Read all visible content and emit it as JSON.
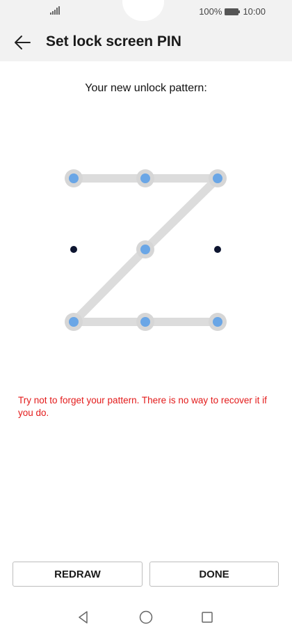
{
  "status_bar": {
    "battery_percent": "100%",
    "time": "10:00",
    "signal_icon": "signal-icon",
    "battery_icon": "battery-icon"
  },
  "header": {
    "back_icon": "arrow-left-icon",
    "title": "Set lock screen PIN"
  },
  "main": {
    "subtitle": "Your new unlock pattern:",
    "pattern_grid": {
      "rows": 3,
      "cols": 3,
      "selected_sequence": [
        1,
        2,
        3,
        5,
        7,
        8,
        9
      ],
      "unselected": [
        4,
        6
      ]
    },
    "warning": "Try not to forget your pattern. There is no way to recover it if you do."
  },
  "actions": {
    "redraw_label": "REDRAW",
    "done_label": "DONE"
  },
  "nav_bar": {
    "back_icon": "triangle-back-icon",
    "home_icon": "circle-home-icon",
    "recents_icon": "square-recents-icon"
  },
  "colors": {
    "accent_dot": "#6aa6e6",
    "dot_halo": "#d6d6d6",
    "line": "#dcdcdc",
    "warning": "#e31a1a",
    "unselected_dot": "#0d1530"
  }
}
